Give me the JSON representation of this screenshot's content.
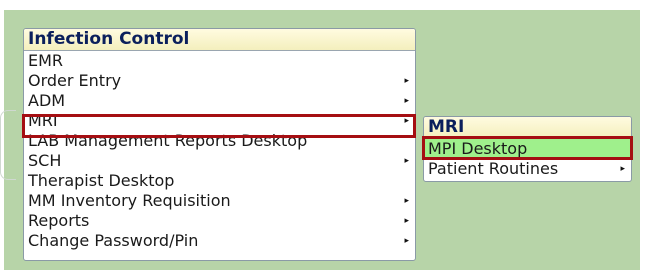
{
  "main_menu": {
    "title": "Infection Control",
    "items": [
      {
        "label": "EMR",
        "arrow": ""
      },
      {
        "label": "Order Entry",
        "arrow": "▸"
      },
      {
        "label": "ADM",
        "arrow": "▸"
      },
      {
        "label": "MRI",
        "arrow": "▸"
      },
      {
        "label": "LAB Management Reports Desktop",
        "arrow": ""
      },
      {
        "label": "SCH",
        "arrow": "▸"
      },
      {
        "label": "Therapist Desktop",
        "arrow": ""
      },
      {
        "label": "MM Inventory Requisition",
        "arrow": "▸"
      },
      {
        "label": "Reports",
        "arrow": "▸"
      },
      {
        "label": "Change Password/Pin",
        "arrow": "▸"
      }
    ]
  },
  "submenu": {
    "title": "MRI",
    "items": [
      {
        "label": "MPI Desktop",
        "arrow": ""
      },
      {
        "label": "Patient Routines",
        "arrow": "▸"
      }
    ]
  },
  "colors": {
    "background": "#b7d4a8",
    "header_bg": "#f4efbd",
    "header_text": "#0b1f5c",
    "selected_bg": "#9ff08c",
    "highlight_border": "#a50e12"
  }
}
